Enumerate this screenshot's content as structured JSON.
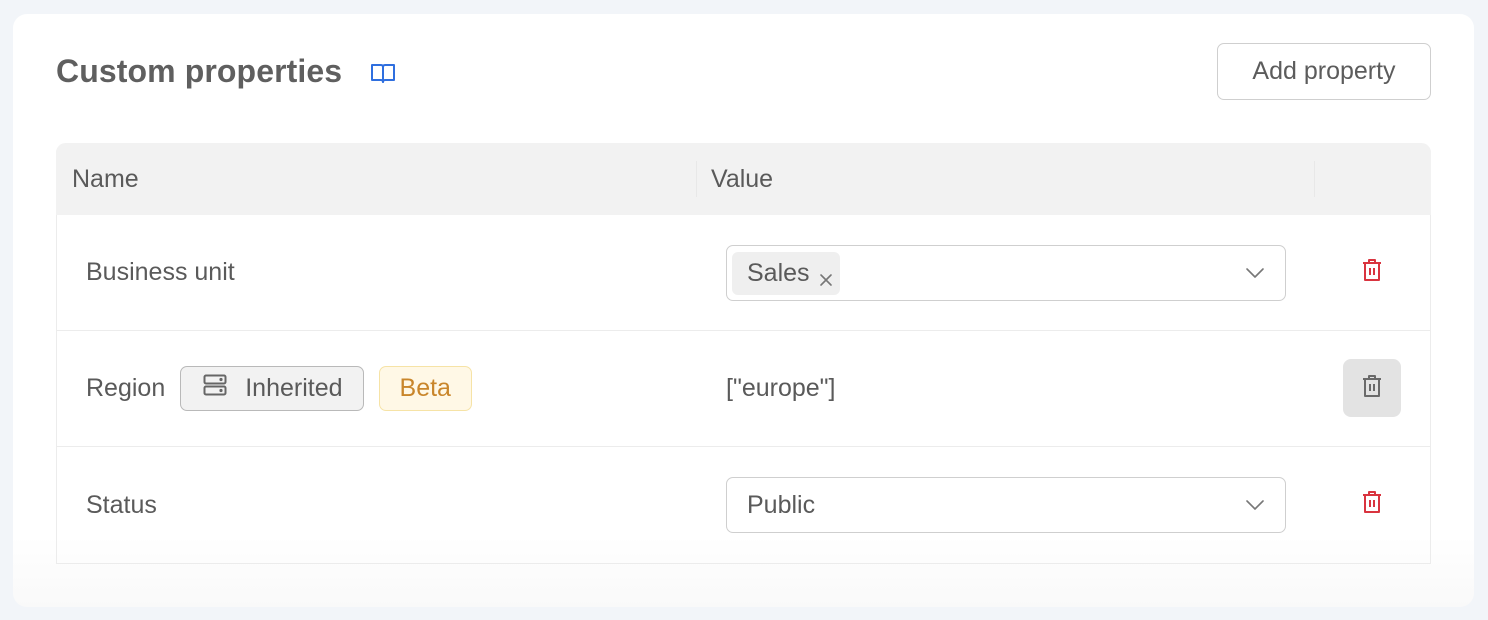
{
  "header": {
    "title": "Custom properties",
    "docs_icon": "book-open-icon",
    "add_button_label": "Add property"
  },
  "table": {
    "columns": [
      "Name",
      "Value",
      ""
    ],
    "rows": [
      {
        "name": "Business unit",
        "value_type": "multiselect",
        "tags": [
          "Sales"
        ],
        "delete_enabled": true
      },
      {
        "name": "Region",
        "badges": {
          "inherited": {
            "label": "Inherited",
            "icon": "server-icon"
          },
          "beta": {
            "label": "Beta"
          }
        },
        "value_type": "text",
        "value": "[\"europe\"]",
        "delete_enabled": false
      },
      {
        "name": "Status",
        "value_type": "select",
        "value": "Public",
        "delete_enabled": true
      }
    ]
  },
  "colors": {
    "accent": "#2f6fdf",
    "danger": "#d9343f",
    "beta_text": "#c9862b",
    "beta_bg": "#fff8e6"
  }
}
